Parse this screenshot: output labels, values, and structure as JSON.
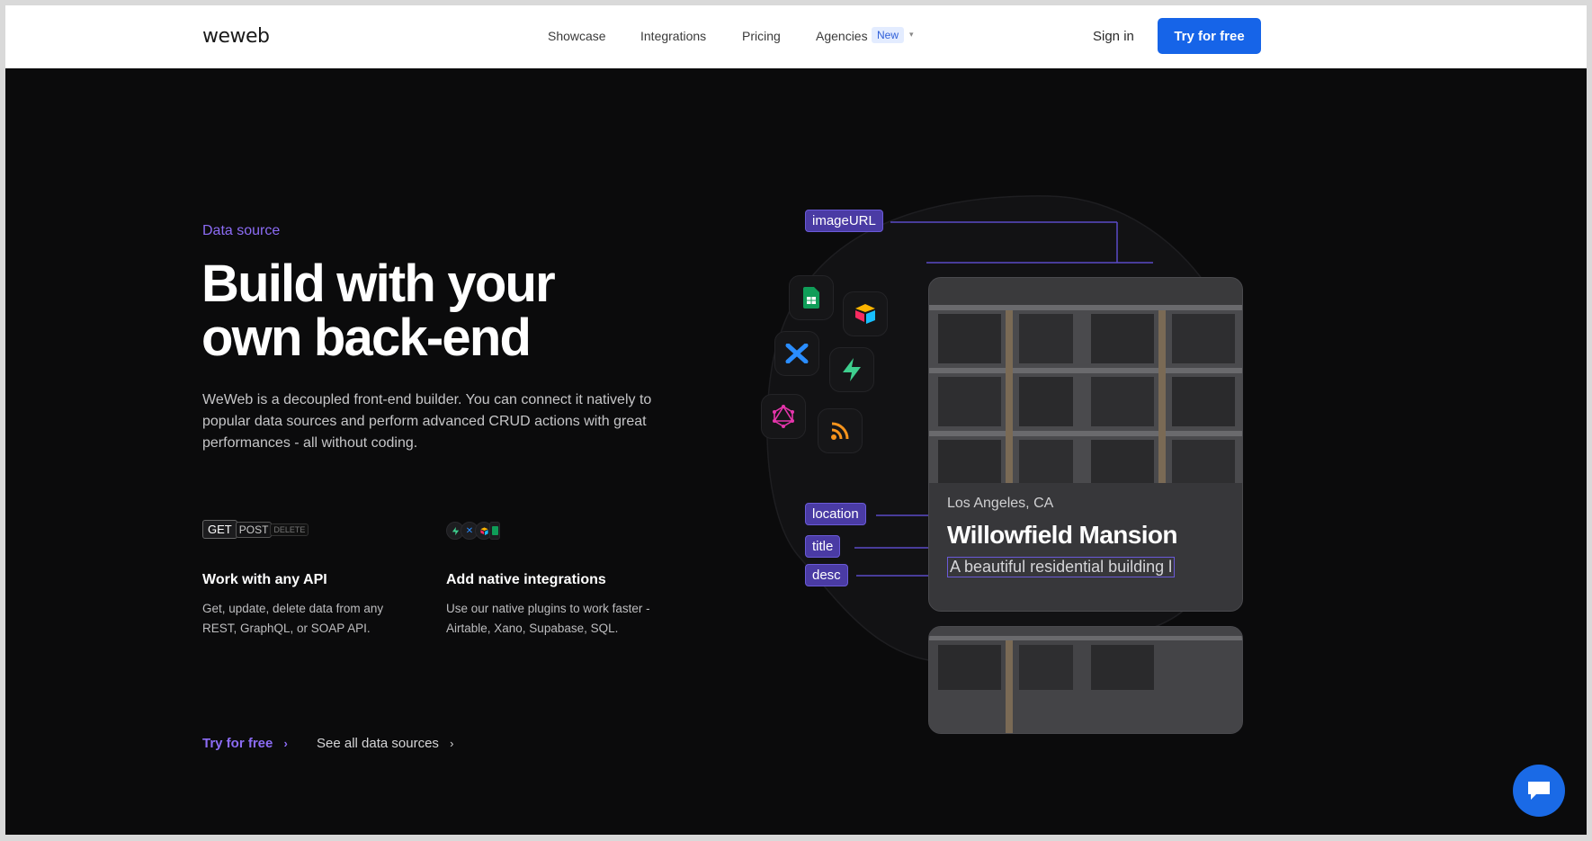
{
  "nav": {
    "logo": "weweb",
    "links": [
      "Showcase",
      "Integrations",
      "Pricing",
      "Agencies"
    ],
    "new_badge": "New",
    "sign_in": "Sign in",
    "cta": "Try for free"
  },
  "hero": {
    "eyebrow": "Data source",
    "headline_line1": "Build with your",
    "headline_line2": "own back-end",
    "lead": "WeWeb is a decoupled front-end builder. You can connect it natively to popular data sources and perform advanced CRUD actions with great performances - all without coding."
  },
  "features": [
    {
      "pills": [
        "GET",
        "POST",
        "DELETE"
      ],
      "title": "Work with any API",
      "desc": "Get, update, delete data from any REST, GraphQL, or SOAP API."
    },
    {
      "title": "Add native integrations",
      "desc": "Use our native plugins to work faster - Airtable, Xano, Supabase, SQL."
    }
  ],
  "ctas": {
    "try": "Try for free",
    "see_all": "See all data sources",
    "chevron": "›"
  },
  "illustration": {
    "tags": {
      "image": "imageURL",
      "location": "location",
      "title": "title",
      "desc": "desc"
    },
    "card": {
      "location": "Los Angeles, CA",
      "title": "Willowfield Mansion",
      "desc": "A beautiful residential building l"
    },
    "icons": [
      "google-sheets-icon",
      "airtable-icon",
      "xano-icon",
      "supabase-icon",
      "graphql-icon",
      "rss-icon"
    ]
  },
  "colors": {
    "accent_purple": "#8c6cf5",
    "brand_blue": "#1664e8",
    "tag_bg": "#4a3ba4",
    "background": "#0b0b0c"
  }
}
